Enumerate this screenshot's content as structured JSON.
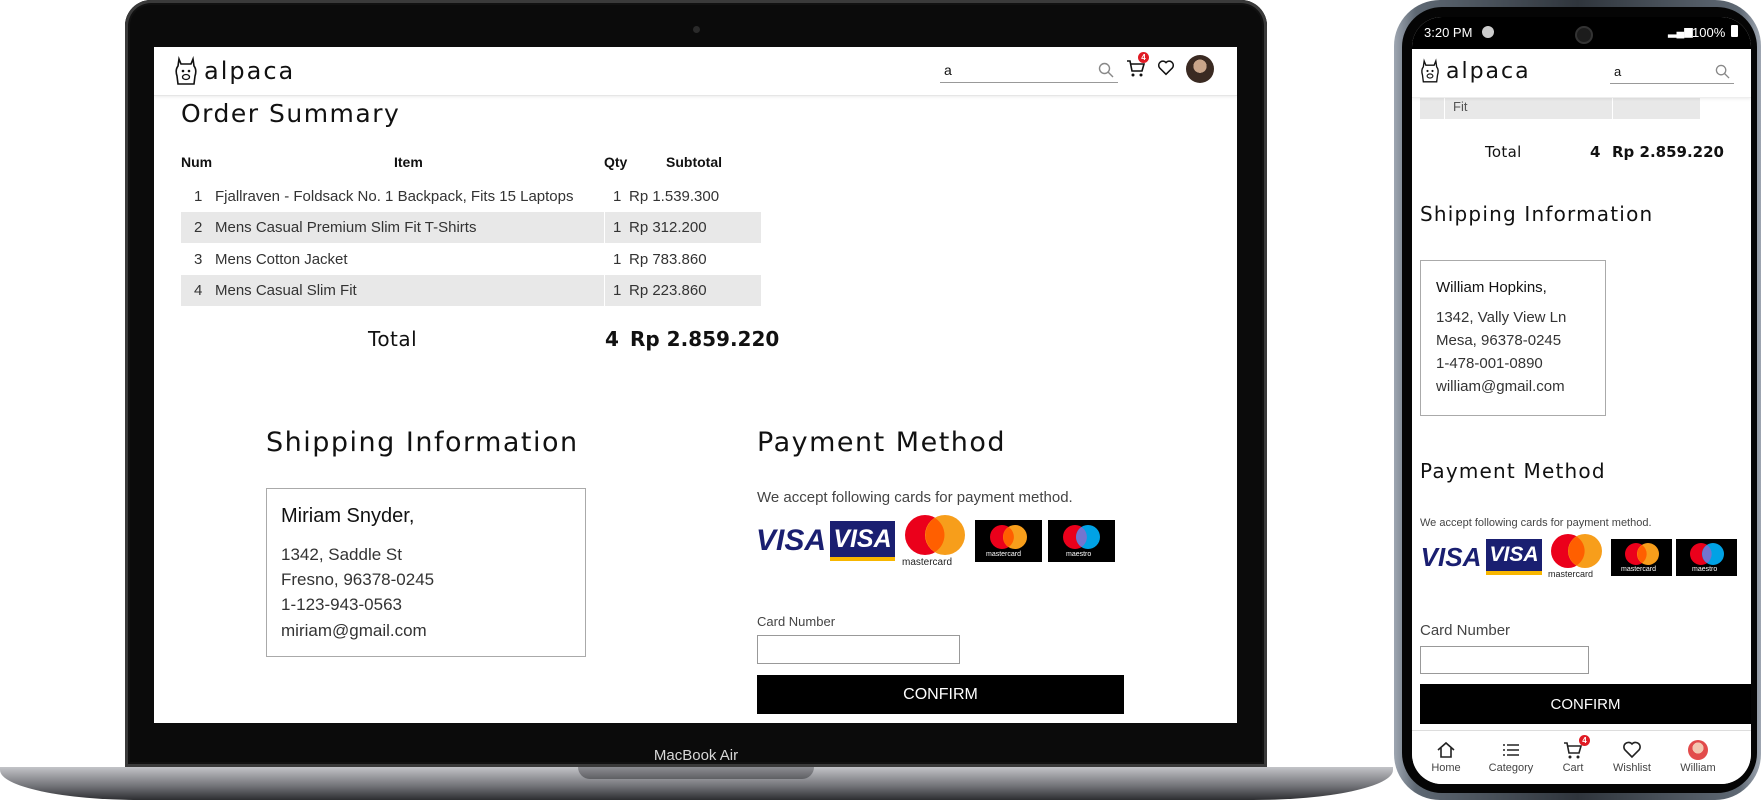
{
  "store": {
    "brand": "alpaca",
    "search_value": "a",
    "cart_count": "4"
  },
  "laptop": {
    "device_label": "MacBook Air",
    "order_summary": {
      "title": "Order Summary",
      "headers": {
        "num": "Num",
        "item": "Item",
        "qty": "Qty",
        "subtotal": "Subtotal"
      },
      "rows": [
        {
          "num": "1",
          "item": "Fjallraven - Foldsack No. 1 Backpack, Fits 15 Laptops",
          "qty": "1",
          "subtotal": "Rp 1.539.300"
        },
        {
          "num": "2",
          "item": "Mens Casual Premium Slim Fit T-Shirts",
          "qty": "1",
          "subtotal": "Rp 312.200"
        },
        {
          "num": "3",
          "item": "Mens Cotton Jacket",
          "qty": "1",
          "subtotal": "Rp 783.860"
        },
        {
          "num": "4",
          "item": "Mens Casual Slim Fit",
          "qty": "1",
          "subtotal": "Rp 223.860"
        }
      ],
      "total_label": "Total",
      "total_qty": "4",
      "total_amount": "Rp 2.859.220"
    },
    "shipping": {
      "title": "Shipping Information",
      "name": "Miriam Snyder,",
      "street": "1342, Saddle St",
      "city": "Fresno, 96378-0245",
      "phone": "1-123-943-0563",
      "email": "miriam@gmail.com"
    },
    "payment": {
      "title": "Payment Method",
      "description": "We accept following cards for payment method.",
      "card_label": "Card Number",
      "card_value": "",
      "confirm_label": "CONFIRM"
    }
  },
  "cards": {
    "visa": "VISA",
    "mastercard": "mastercard",
    "maestro": "maestro"
  },
  "phone": {
    "time": "3:20 PM",
    "battery": "100%",
    "partial_row_text": "Fit",
    "total_label": "Total",
    "total_qty": "4",
    "total_amount": "Rp 2.859.220",
    "shipping": {
      "title": "Shipping Information",
      "name": "William Hopkins,",
      "street": "1342, Vally View Ln",
      "city": "Mesa, 96378-0245",
      "phone": "1-478-001-0890",
      "email": "william@gmail.com"
    },
    "payment": {
      "title": "Payment Method",
      "description": "We accept following cards for payment method.",
      "card_label": "Card Number",
      "card_value": "",
      "confirm_label": "CONFIRM"
    },
    "bottom_nav": [
      {
        "label": "Home",
        "icon": "home-icon"
      },
      {
        "label": "Category",
        "icon": "list-icon"
      },
      {
        "label": "Cart",
        "icon": "cart-icon"
      },
      {
        "label": "Wishlist",
        "icon": "heart-icon"
      },
      {
        "label": "William",
        "icon": "avatar"
      }
    ]
  },
  "colors": {
    "accent": "#000000",
    "badge": "#e01b24",
    "row_stripe": "#e8e8e8",
    "visa_blue": "#1a1f71"
  }
}
